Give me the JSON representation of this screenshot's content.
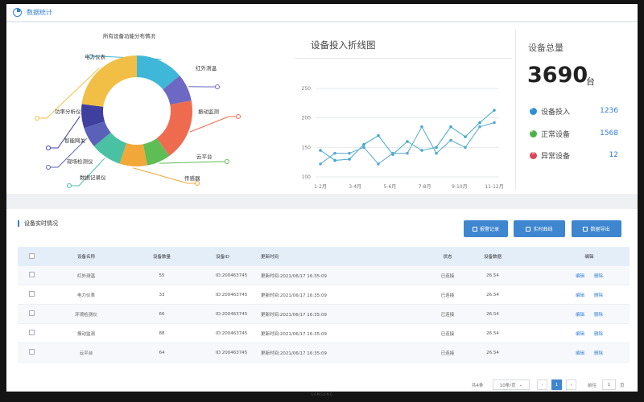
{
  "header": {
    "title": "数据统计"
  },
  "donut": {
    "title": "所有设备功能分布情况",
    "segments": [
      {
        "label": "电力仪表",
        "value": 14,
        "color": "#3fb7d9"
      },
      {
        "label": "红外测温",
        "value": 8,
        "color": "#6d68c4"
      },
      {
        "label": "振动监测",
        "value": 18,
        "color": "#ef6b4f"
      },
      {
        "label": "云平台",
        "value": 7,
        "color": "#5fbd55"
      },
      {
        "label": "传感器",
        "value": 8,
        "color": "#f2a838"
      },
      {
        "label": "数据记录仪",
        "value": 9,
        "color": "#4bc1a4"
      },
      {
        "label": "现场检测仪",
        "value": 6,
        "color": "#5a61b8"
      },
      {
        "label": "智能网关",
        "value": 7,
        "color": "#3e3f9f"
      },
      {
        "label": "功率分析仪",
        "value": 23,
        "color": "#f1bf45"
      }
    ]
  },
  "line_chart": {
    "title": "设备投入折线图"
  },
  "chart_data": {
    "type": "line",
    "categories": [
      "1-2月",
      "3-4月",
      "5-6月",
      "7-8月",
      "9-10月",
      "11-12月"
    ],
    "ylim": [
      100,
      250
    ],
    "yticks": [
      100,
      150,
      200,
      250
    ],
    "grid": true,
    "series": [
      {
        "color": "#3fa9c8",
        "values": [
          145,
          128,
          130,
          155,
          170,
          138,
          160,
          145,
          150,
          185,
          168,
          192,
          213
        ]
      },
      {
        "color": "#5aa8cf",
        "values": [
          122,
          140,
          140,
          150,
          122,
          140,
          140,
          185,
          140,
          162,
          150,
          185,
          192
        ]
      }
    ]
  },
  "summary": {
    "label": "设备总量",
    "value": "3690",
    "unit": "台",
    "stats": [
      {
        "label": "设备投入",
        "value": "1236",
        "color": "#2f8fd4"
      },
      {
        "label": "正常设备",
        "value": "1568",
        "color": "#4db04a"
      },
      {
        "label": "异常设备",
        "value": "12",
        "color": "#d9475a"
      }
    ]
  },
  "realtime": {
    "title": "设备实时情况",
    "buttons": {
      "alarm": "报警记录",
      "curve": "实时曲线",
      "export": "数据导出"
    },
    "columns": [
      "设备名称",
      "设备数量",
      "设备ID",
      "更新时间",
      "状态",
      "设备数据",
      "编辑"
    ],
    "rows": [
      {
        "name": "红外测温",
        "count": "55",
        "id": "ID:200463745",
        "time": "更新时间:2021/06/17 16:35:09",
        "status": "已连接",
        "data": "26.54",
        "edit": "编辑",
        "del": "删除"
      },
      {
        "name": "电力仪表",
        "count": "33",
        "id": "ID:200463745",
        "time": "更新时间:2021/06/17 16:35:09",
        "status": "已连接",
        "data": "26.54",
        "edit": "编辑",
        "del": "删除"
      },
      {
        "name": "环境检测仪",
        "count": "66",
        "id": "ID:200463745",
        "time": "更新时间:2021/06/17 16:35:09",
        "status": "已连接",
        "data": "26.54",
        "edit": "编辑",
        "del": "删除"
      },
      {
        "name": "振动监测",
        "count": "88",
        "id": "ID:200463745",
        "time": "更新时间:2021/06/17 16:35:09",
        "status": "已连接",
        "data": "26.54",
        "edit": "编辑",
        "del": "删除"
      },
      {
        "name": "云平台",
        "count": "64",
        "id": "ID:200463745",
        "time": "更新时间:2021/06/17 16:35:09",
        "status": "已连接",
        "data": "26.54",
        "edit": "编辑",
        "del": "删除"
      }
    ],
    "pagination": {
      "total": "共4条",
      "page_size": "10条/页",
      "prev": "‹",
      "current": "1",
      "next": "›",
      "goto": "前往",
      "goto_value": "1",
      "page_unit": "页"
    }
  },
  "brand": "SAMSUNG"
}
